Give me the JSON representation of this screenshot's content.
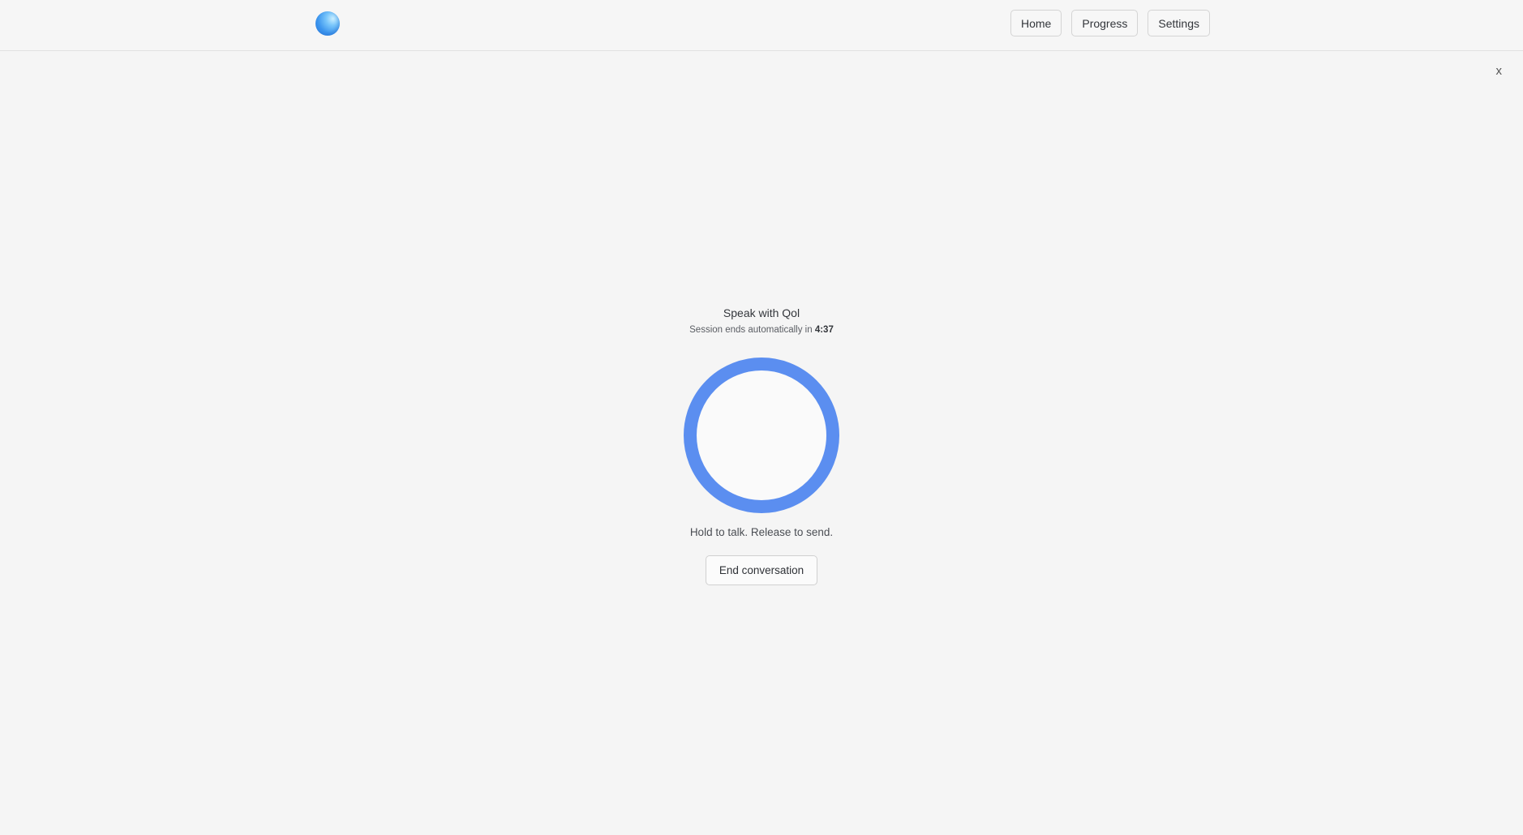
{
  "header": {
    "logo_icon": "blue-orb-logo",
    "nav": [
      {
        "label": "Home"
      },
      {
        "label": "Progress"
      },
      {
        "label": "Settings"
      }
    ]
  },
  "close_label": "x",
  "session": {
    "title": "Speak with Qol",
    "subtitle_prefix": "Session ends automatically in ",
    "time_remaining": "4:37",
    "mic_icon": "push-to-talk-ring",
    "hint": "Hold to talk. Release to send.",
    "end_label": "End conversation"
  },
  "colors": {
    "accent": "#5b8ef0",
    "background": "#f5f5f5"
  }
}
